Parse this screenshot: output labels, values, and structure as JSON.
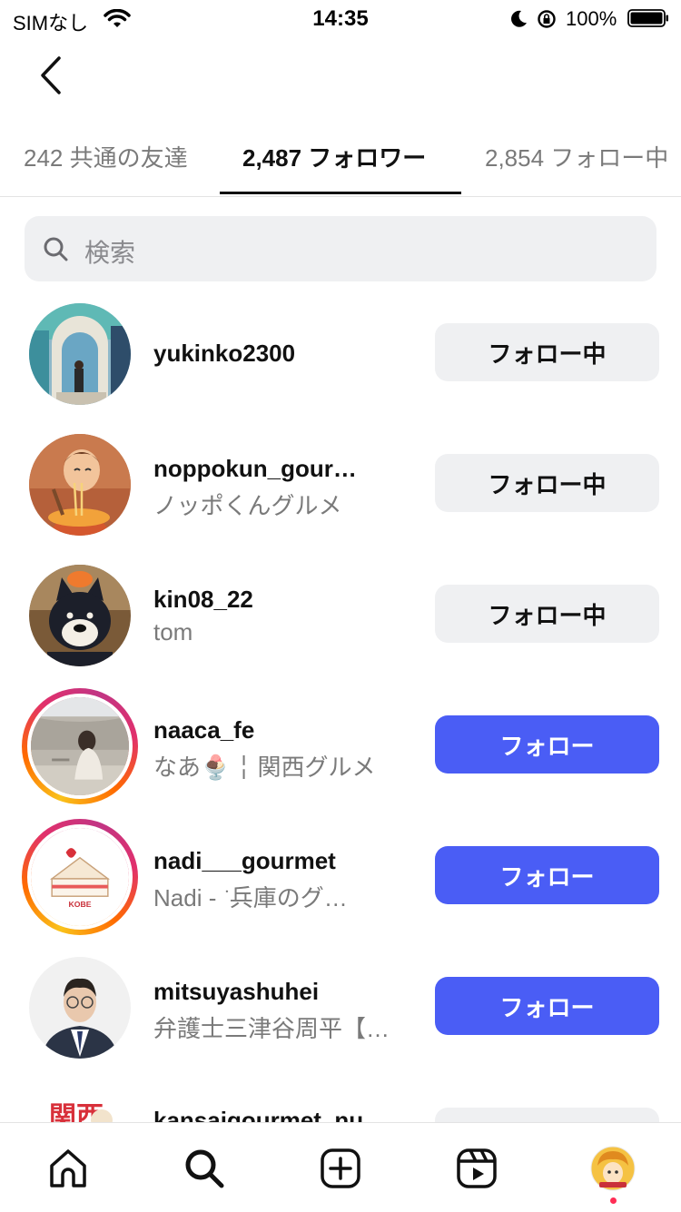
{
  "status": {
    "carrier": "SIMなし",
    "time": "14:35",
    "battery": "100%"
  },
  "tabs": [
    {
      "label": "242 共通の友達"
    },
    {
      "label": "2,487 フォロワー"
    },
    {
      "label": "2,854 フォロー中"
    }
  ],
  "search": {
    "placeholder": "検索"
  },
  "users": [
    {
      "username": "yukinko2300",
      "name": "",
      "button": "フォロー中"
    },
    {
      "username": "noppokun_gour…",
      "name": "ノッポくんグルメ",
      "button": "フォロー中"
    },
    {
      "username": "kin08_22",
      "name": "tom",
      "button": "フォロー中"
    },
    {
      "username": "naaca_fe",
      "name": "なあ🍨 ╎ 関西グルメ",
      "button": "フォロー"
    },
    {
      "username": "nadi___gourmet",
      "name": "Nadi ‐ ͘ 兵庫のグ…",
      "button": "フォロー"
    },
    {
      "username": "mitsuyashuhei",
      "name": "弁護士三津谷周平【…",
      "button": "フォロー"
    },
    {
      "username": "kansaigourmet_nu",
      "name": "",
      "button": ""
    }
  ],
  "avatar_cake_text": "KOBE",
  "avatar_kanji": "関西",
  "colors": {
    "follow_blue": "#4a5df5",
    "button_gray": "#eff0f2",
    "notification_dot": "#ff2d55"
  },
  "nav": {
    "icons": [
      "home-icon",
      "search-icon",
      "create-icon",
      "reels-icon",
      "profile-avatar"
    ]
  }
}
